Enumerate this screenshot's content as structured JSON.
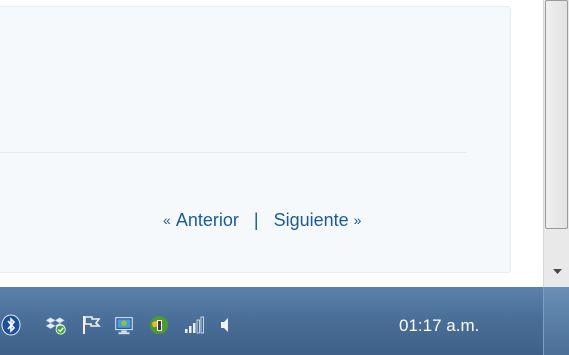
{
  "pagination": {
    "prev_arrow": "«",
    "prev_label": "Anterior",
    "separator": "|",
    "next_label": "Siguiente",
    "next_arrow": "»"
  },
  "taskbar": {
    "tray_icons": [
      "bluetooth-icon",
      "dropbox-icon",
      "action-center-flag-icon",
      "network-monitor-icon",
      "update-globe-icon",
      "signal-strength-icon",
      "volume-icon"
    ],
    "clock": "01:17 a.m."
  },
  "colors": {
    "link": "#1a5c96",
    "taskbar": "#4a6f98",
    "panel": "#f6f9fc"
  }
}
